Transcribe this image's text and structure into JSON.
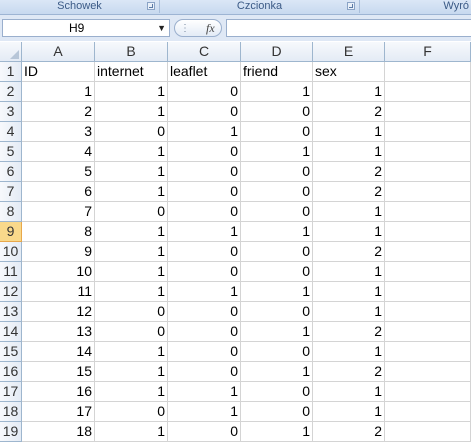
{
  "ribbon": {
    "groups": [
      "Schowek",
      "Czcionka",
      "Wyró"
    ]
  },
  "formula_bar": {
    "name_box": "H9",
    "fx_label": "fx",
    "formula": ""
  },
  "sheet": {
    "columns": [
      "A",
      "B",
      "C",
      "D",
      "E",
      "F"
    ],
    "selected_row": 9,
    "rows": [
      {
        "n": "1",
        "cells": [
          "ID",
          "internet",
          "leaflet",
          "friend",
          "sex",
          ""
        ]
      },
      {
        "n": "2",
        "cells": [
          "1",
          "1",
          "0",
          "1",
          "1",
          ""
        ]
      },
      {
        "n": "3",
        "cells": [
          "2",
          "1",
          "0",
          "0",
          "2",
          ""
        ]
      },
      {
        "n": "4",
        "cells": [
          "3",
          "0",
          "1",
          "0",
          "1",
          ""
        ]
      },
      {
        "n": "5",
        "cells": [
          "4",
          "1",
          "0",
          "1",
          "1",
          ""
        ]
      },
      {
        "n": "6",
        "cells": [
          "5",
          "1",
          "0",
          "0",
          "2",
          ""
        ]
      },
      {
        "n": "7",
        "cells": [
          "6",
          "1",
          "0",
          "0",
          "2",
          ""
        ]
      },
      {
        "n": "8",
        "cells": [
          "7",
          "0",
          "0",
          "0",
          "1",
          ""
        ]
      },
      {
        "n": "9",
        "cells": [
          "8",
          "1",
          "1",
          "1",
          "1",
          ""
        ]
      },
      {
        "n": "10",
        "cells": [
          "9",
          "1",
          "0",
          "0",
          "2",
          ""
        ]
      },
      {
        "n": "11",
        "cells": [
          "10",
          "1",
          "0",
          "0",
          "1",
          ""
        ]
      },
      {
        "n": "12",
        "cells": [
          "11",
          "1",
          "1",
          "1",
          "1",
          ""
        ]
      },
      {
        "n": "13",
        "cells": [
          "12",
          "0",
          "0",
          "0",
          "1",
          ""
        ]
      },
      {
        "n": "14",
        "cells": [
          "13",
          "0",
          "0",
          "1",
          "2",
          ""
        ]
      },
      {
        "n": "15",
        "cells": [
          "14",
          "1",
          "0",
          "0",
          "1",
          ""
        ]
      },
      {
        "n": "16",
        "cells": [
          "15",
          "1",
          "0",
          "1",
          "2",
          ""
        ]
      },
      {
        "n": "17",
        "cells": [
          "16",
          "1",
          "1",
          "0",
          "1",
          ""
        ]
      },
      {
        "n": "18",
        "cells": [
          "17",
          "0",
          "1",
          "0",
          "1",
          ""
        ]
      },
      {
        "n": "19",
        "cells": [
          "18",
          "1",
          "0",
          "1",
          "2",
          ""
        ]
      }
    ]
  },
  "colors": {
    "selected_row_header": "#f9d98b",
    "grid_line": "#d4d4d4"
  }
}
